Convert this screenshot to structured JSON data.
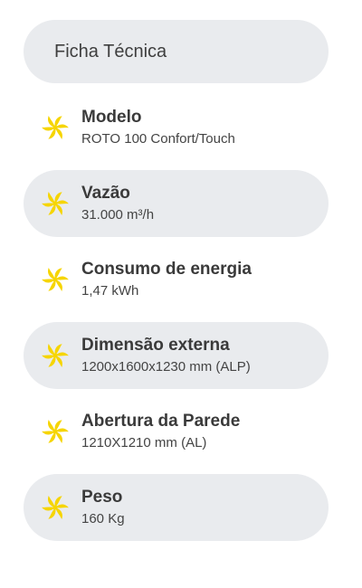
{
  "title": "Ficha Técnica",
  "accent_color": "#f6d500",
  "icon": "fan-icon",
  "specs": [
    {
      "label": "Modelo",
      "value": "ROTO 100 Confort/Touch"
    },
    {
      "label": "Vazão",
      "value": "31.000 m³/h"
    },
    {
      "label": "Consumo de energia",
      "value": "1,47 kWh"
    },
    {
      "label": "Dimensão externa",
      "value": "1200x1600x1230 mm (ALP)"
    },
    {
      "label": "Abertura da Parede",
      "value": "1210X1210 mm (AL)"
    },
    {
      "label": "Peso",
      "value": "160 Kg"
    }
  ]
}
